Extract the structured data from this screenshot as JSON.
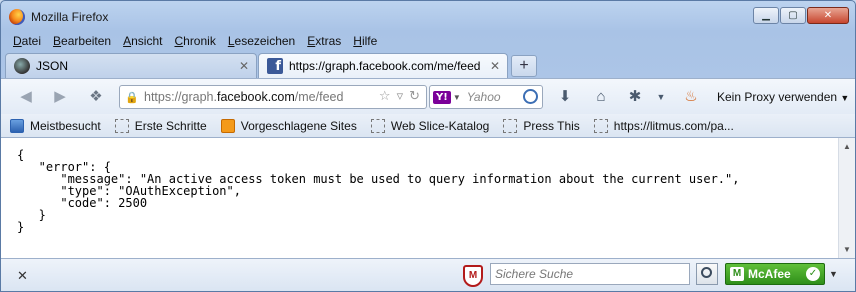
{
  "window": {
    "title": "Mozilla Firefox"
  },
  "menu": [
    {
      "accel": "D",
      "rest": "atei"
    },
    {
      "accel": "B",
      "rest": "earbeiten"
    },
    {
      "accel": "A",
      "rest": "nsicht"
    },
    {
      "accel": "C",
      "rest": "hronik"
    },
    {
      "accel": "L",
      "rest": "esezeichen"
    },
    {
      "accel": "E",
      "rest": "xtras"
    },
    {
      "accel": "H",
      "rest": "ilfe"
    }
  ],
  "tabs": [
    {
      "label": "JSON",
      "icon": "json-icon"
    },
    {
      "label": "https://graph.facebook.com/me/feed",
      "icon": "facebook-icon"
    }
  ],
  "navbar": {
    "url_prefix": "https://graph.",
    "url_domain": "facebook.com",
    "url_suffix": "/me/feed",
    "search_engine": "Y!",
    "search_placeholder": "Yahoo",
    "proxy_label": "Kein Proxy verwenden"
  },
  "bookmarks": [
    {
      "label": "Meistbesucht",
      "icon": "bookmarks-icon"
    },
    {
      "label": "Erste Schritte",
      "icon": "page-icon"
    },
    {
      "label": "Vorgeschlagene Sites",
      "icon": "bulb-icon"
    },
    {
      "label": "Web Slice-Katalog",
      "icon": "page-icon"
    },
    {
      "label": "Press This",
      "icon": "page-icon"
    },
    {
      "label": "https://litmus.com/pa...",
      "icon": "page-icon"
    }
  ],
  "content": {
    "json_text": "{\n   \"error\": {\n      \"message\": \"An active access token must be used to query information about the current user.\",\n      \"type\": \"OAuthException\",\n      \"code\": 2500\n   }\n}"
  },
  "statusbar": {
    "shield_letter": "M",
    "safe_search_placeholder": "Sichere Suche",
    "mcafee_label": "McAfee"
  },
  "colors": {
    "mcafee_green": "#2f8f1a",
    "facebook_blue": "#3b5998",
    "mcafee_red": "#b31b1b"
  }
}
